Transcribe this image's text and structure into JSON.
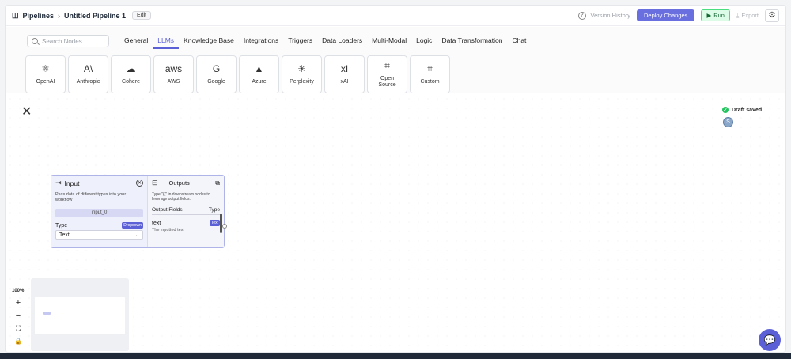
{
  "header": {
    "breadcrumb_root": "Pipelines",
    "pipeline_name": "Untitled Pipeline 1",
    "edit_label": "Edit",
    "version_history": "Version History",
    "deploy_label": "Deploy Changes",
    "run_label": "Run",
    "export_label": "Export"
  },
  "toolbar": {
    "search_placeholder": "Search Nodes",
    "tabs": [
      "General",
      "LLMs",
      "Knowledge Base",
      "Integrations",
      "Triggers",
      "Data Loaders",
      "Multi-Modal",
      "Logic",
      "Data Transformation",
      "Chat"
    ],
    "active_tab": "LLMs",
    "tiles": [
      {
        "label": "OpenAI",
        "icon": "openai-icon",
        "glyph": "⚛"
      },
      {
        "label": "Anthropic",
        "icon": "anthropic-icon",
        "glyph": "A\\"
      },
      {
        "label": "Cohere",
        "icon": "cohere-icon",
        "glyph": "☁"
      },
      {
        "label": "AWS",
        "icon": "aws-icon",
        "glyph": "aws"
      },
      {
        "label": "Google",
        "icon": "google-icon",
        "glyph": "G"
      },
      {
        "label": "Azure",
        "icon": "azure-icon",
        "glyph": "▲"
      },
      {
        "label": "Perplexity",
        "icon": "perplexity-icon",
        "glyph": "✳"
      },
      {
        "label": "xAI",
        "icon": "xai-icon",
        "glyph": "xI"
      },
      {
        "label": "Open Source",
        "icon": "crop-icon",
        "glyph": "⌗"
      },
      {
        "label": "Custom",
        "icon": "crop-icon",
        "glyph": "⌗"
      }
    ]
  },
  "canvas": {
    "draft_status": "Draft saved",
    "avatar_initial": "S",
    "zoom": "100%"
  },
  "node": {
    "title": "Input",
    "description": "Pass data of different types into your workflow",
    "name": "input_0",
    "type_label": "Type",
    "type_tag": "Dropdown",
    "type_value": "Text",
    "outputs_title": "Outputs",
    "outputs_desc": "Type \"{{\" in downstream nodes to leverage output fields.",
    "output_fields_label": "Output Fields",
    "output_type_label": "Type",
    "field_name": "text",
    "field_tag": "Text",
    "field_desc": "The inputted text"
  },
  "colors": {
    "accent": "#5b60d6",
    "deploy": "#6a6fe0",
    "run_bg": "#dcfce7"
  }
}
